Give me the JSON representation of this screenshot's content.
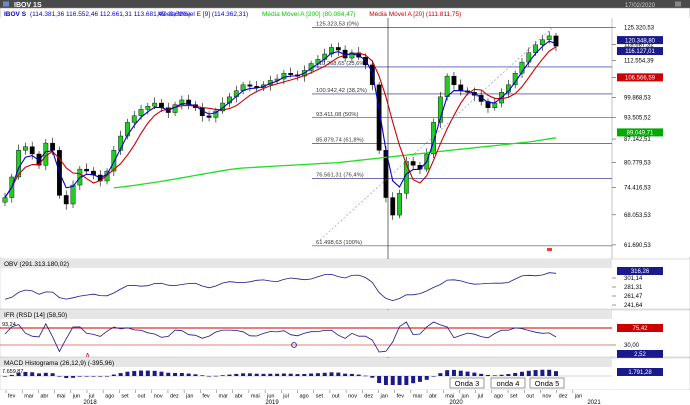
{
  "window": {
    "title": "IBOV 1S",
    "date": "17/02/2020"
  },
  "header": {
    "symbol": "IBOV S",
    "ohlc": "(114.381,36 116.552,46 112.661,31 113.681,42 -0,61%)",
    "ma_labels": [
      {
        "text": "Média Móvel E [9] (114.362,31)",
        "color": "#0000cc"
      },
      {
        "text": "Média Móvel A [200] (80.084,47)",
        "color": "#00cc00"
      },
      {
        "text": "Média Móvel A [20] (111.811,75)",
        "color": "#cc0000"
      }
    ]
  },
  "panels": {
    "obv": {
      "label": "OBV (291.313.180,02)",
      "ticks": [
        "301,14",
        "281,31",
        "261,47",
        "241,64"
      ],
      "badge": "316,26",
      "badge_color": "#1a1a8c"
    },
    "ifr": {
      "label": "IFR (RSD [14] (58,50)",
      "top_value": "93,24",
      "ticks": [
        "30,00"
      ],
      "badges": [
        {
          "text": "75,42",
          "color": "#cc0000"
        },
        {
          "text": "2,52",
          "color": "#1a1a8c"
        }
      ]
    },
    "macd": {
      "label": "MACD Histograma (26,12,9) (-395,96)",
      "top_value": "7.659,87",
      "badge": "1.791,28",
      "badge_color": "#1a1a8c",
      "waves": [
        "Onda 3",
        "onda 4",
        "Onda 5"
      ]
    }
  },
  "x_axis": {
    "months": [
      "fev",
      "mar",
      "abr",
      "mai",
      "jun",
      "jul",
      "ago",
      "set",
      "out",
      "nov",
      "dez",
      "jan",
      "fev",
      "mar",
      "abr",
      "mai",
      "jun",
      "jul",
      "ago",
      "set",
      "out",
      "nov",
      "dez",
      "jan",
      "fev",
      "mar",
      "abr",
      "mai",
      "jun",
      "jul",
      "ago",
      "set",
      "out",
      "nov",
      "dez",
      "jan"
    ],
    "years": [
      "2018",
      "2019",
      "2020",
      "2021"
    ]
  },
  "chart_data": {
    "type": "candlestick",
    "y_scale": "log",
    "ylim": [
      59500,
      128500
    ],
    "y_ticks": [
      125320.53,
      118687.32,
      112554.39,
      106566.59,
      99868.53,
      93505.52,
      87142.51,
      80779.53,
      74416.53,
      68053.53,
      61690.53
    ],
    "y_tick_labels": [
      "125.320,53",
      "118.687,32",
      "112.554,39",
      "106.566,59",
      "99.868,53",
      "93.505,52",
      "87.142,51",
      "80.779,53",
      "74.416,53",
      "68.053,53",
      "61.690,53"
    ],
    "price_badges": [
      {
        "value": 120348.8,
        "text": "120.348,80",
        "color": "#1a1a8c"
      },
      {
        "value": 116127.01,
        "text": "116.127,01",
        "color": "#1a1a8c"
      },
      {
        "value": 106566.59,
        "text": "106.566,59",
        "color": "#cc0000"
      },
      {
        "value": 89049.71,
        "text": "89.049,71",
        "color": "#00aa00"
      }
    ],
    "fibonacci": [
      {
        "label": "125.323,53 (0%)",
        "value": 125323.53
      },
      {
        "label": "110.268,65 (23,6%)",
        "value": 110268.65
      },
      {
        "label": "100.942,42 (38,2%)",
        "value": 100942.42
      },
      {
        "label": "93.411,08 (50%)",
        "value": 93411.08
      },
      {
        "label": "85.879,74 (61,8%)",
        "value": 85879.74
      },
      {
        "label": "76.561,31 (76,4%)",
        "value": 76561.31
      },
      {
        "label": "61.498,63 (100%)",
        "value": 61498.63
      }
    ],
    "close": [
      72000,
      77000,
      84000,
      85000,
      83000,
      80000,
      86000,
      84000,
      72500,
      70500,
      75000,
      79000,
      78500,
      77500,
      76000,
      78500,
      84000,
      88000,
      92000,
      94000,
      96000,
      97000,
      98000,
      96500,
      95000,
      97500,
      99000,
      97500,
      96500,
      94000,
      93500,
      95500,
      98000,
      100000,
      102000,
      104000,
      103500,
      103000,
      104000,
      105500,
      106000,
      108000,
      107500,
      107000,
      109000,
      111500,
      113000,
      115000,
      117500,
      116500,
      113500,
      115500,
      113800,
      111000,
      104000,
      84000,
      72000,
      68000,
      73000,
      81000,
      80000,
      79000,
      83000,
      92000,
      100000,
      107000,
      104000,
      102000,
      101500,
      100500,
      98500,
      96500,
      98000,
      101500,
      104000,
      108000,
      112000,
      115500,
      118500,
      120500,
      122000,
      118000
    ],
    "ma_200": [
      72000,
      72140,
      72280,
      72420,
      72560,
      72700,
      72840,
      72980,
      73120,
      73260,
      73400,
      73540,
      73680,
      73820,
      73960,
      74100,
      74300,
      74500,
      74700,
      74900,
      75150,
      75400,
      75650,
      75900,
      76200,
      76500,
      76800,
      77100,
      77400,
      77700,
      78000,
      78300,
      78600,
      78900,
      79100,
      79300,
      79400,
      79500,
      79600,
      79700,
      79800,
      79900,
      80000,
      80100,
      80200,
      80300,
      80400,
      80500,
      80600,
      80700,
      80900,
      81100,
      81300,
      81500,
      81700,
      81900,
      82100,
      82300,
      82500,
      82700,
      82900,
      83100,
      83300,
      83500,
      83700,
      83900,
      84100,
      84300,
      84500,
      84700,
      84900,
      85100,
      85300,
      85500,
      85700,
      85900,
      86100,
      86300,
      86600,
      86900,
      87200,
      87500
    ],
    "candles": 82,
    "vertical_marker": "fev 2020"
  }
}
